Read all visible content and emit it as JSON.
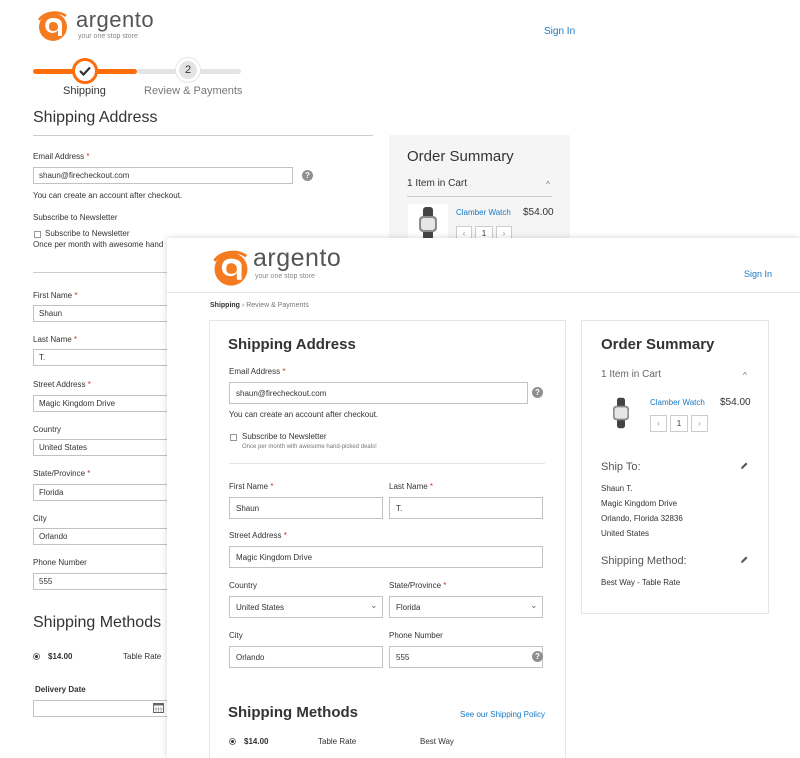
{
  "brand": {
    "name": "argento",
    "tagline": "your one stop store",
    "accent": "#f47b20"
  },
  "background": {
    "sign_in": "Sign In",
    "steps": [
      {
        "number": "",
        "label": "Shipping"
      },
      {
        "number": "2",
        "label": "Review & Payments"
      }
    ],
    "shipping_address_title": "Shipping Address",
    "email": {
      "label": "Email Address",
      "required_mark": "*",
      "value": "shaun@firecheckout.com",
      "note": "You can create an account after checkout."
    },
    "newsletter_title": "Subscribe to Newsletter",
    "newsletter_checkbox_label": "Subscribe to Newsletter",
    "newsletter_note": "Once per month with awesome hand",
    "fields": {
      "first_name": {
        "label": "First Name",
        "value": "Shaun"
      },
      "last_name": {
        "label": "Last Name",
        "value": "T."
      },
      "street": {
        "label": "Street Address",
        "value": "Magic Kingdom Drive"
      },
      "country": {
        "label": "Country",
        "value": "United States"
      },
      "state": {
        "label": "State/Province",
        "value": "Florida"
      },
      "city": {
        "label": "City",
        "value": "Orlando"
      },
      "phone": {
        "label": "Phone Number",
        "value": "555"
      }
    },
    "shipping_methods_title": "Shipping Methods",
    "method": {
      "price": "$14.00",
      "name": "Table Rate"
    },
    "delivery_date_label": "Delivery Date",
    "order_summary": {
      "title": "Order Summary",
      "items_in_cart": "1 Item in Cart",
      "product": {
        "name": "Clamber Watch",
        "price": "$54.00",
        "qty": "1"
      }
    }
  },
  "foreground": {
    "sign_in": "Sign In",
    "breadcrumb": {
      "current": "Shipping",
      "separator": "›",
      "next": "Review & Payments"
    },
    "shipping_address_title": "Shipping Address",
    "email": {
      "label": "Email Address",
      "required_mark": "*",
      "value": "shaun@firecheckout.com",
      "note": "You can create an account after checkout."
    },
    "newsletter_label": "Subscribe to Newsletter",
    "newsletter_note": "Once per month with awesome hand-picked deals!",
    "fields": {
      "first_name": {
        "label": "First Name",
        "value": "Shaun"
      },
      "last_name": {
        "label": "Last Name",
        "value": "T."
      },
      "street": {
        "label": "Street Address",
        "value": "Magic Kingdom Drive"
      },
      "country": {
        "label": "Country",
        "value": "United States"
      },
      "state": {
        "label": "State/Province",
        "value": "Florida"
      },
      "city": {
        "label": "City",
        "value": "Orlando"
      },
      "phone": {
        "label": "Phone Number",
        "value": "555"
      }
    },
    "shipping_methods_title": "Shipping Methods",
    "shipping_policy_link": "See our Shipping Policy",
    "method": {
      "price": "$14.00",
      "name": "Table Rate",
      "carrier": "Best Way"
    },
    "order_summary": {
      "title": "Order Summary",
      "items_in_cart": "1 Item in Cart",
      "product": {
        "name": "Clamber Watch",
        "price": "$54.00",
        "qty": "1"
      },
      "ship_to_title": "Ship To:",
      "ship_to_lines": [
        "Shaun T.",
        "Magic Kingdom Drive",
        "Orlando, Florida 32836",
        "United States"
      ],
      "shipping_method_title": "Shipping Method:",
      "shipping_method_value": "Best Way - Table Rate"
    }
  }
}
